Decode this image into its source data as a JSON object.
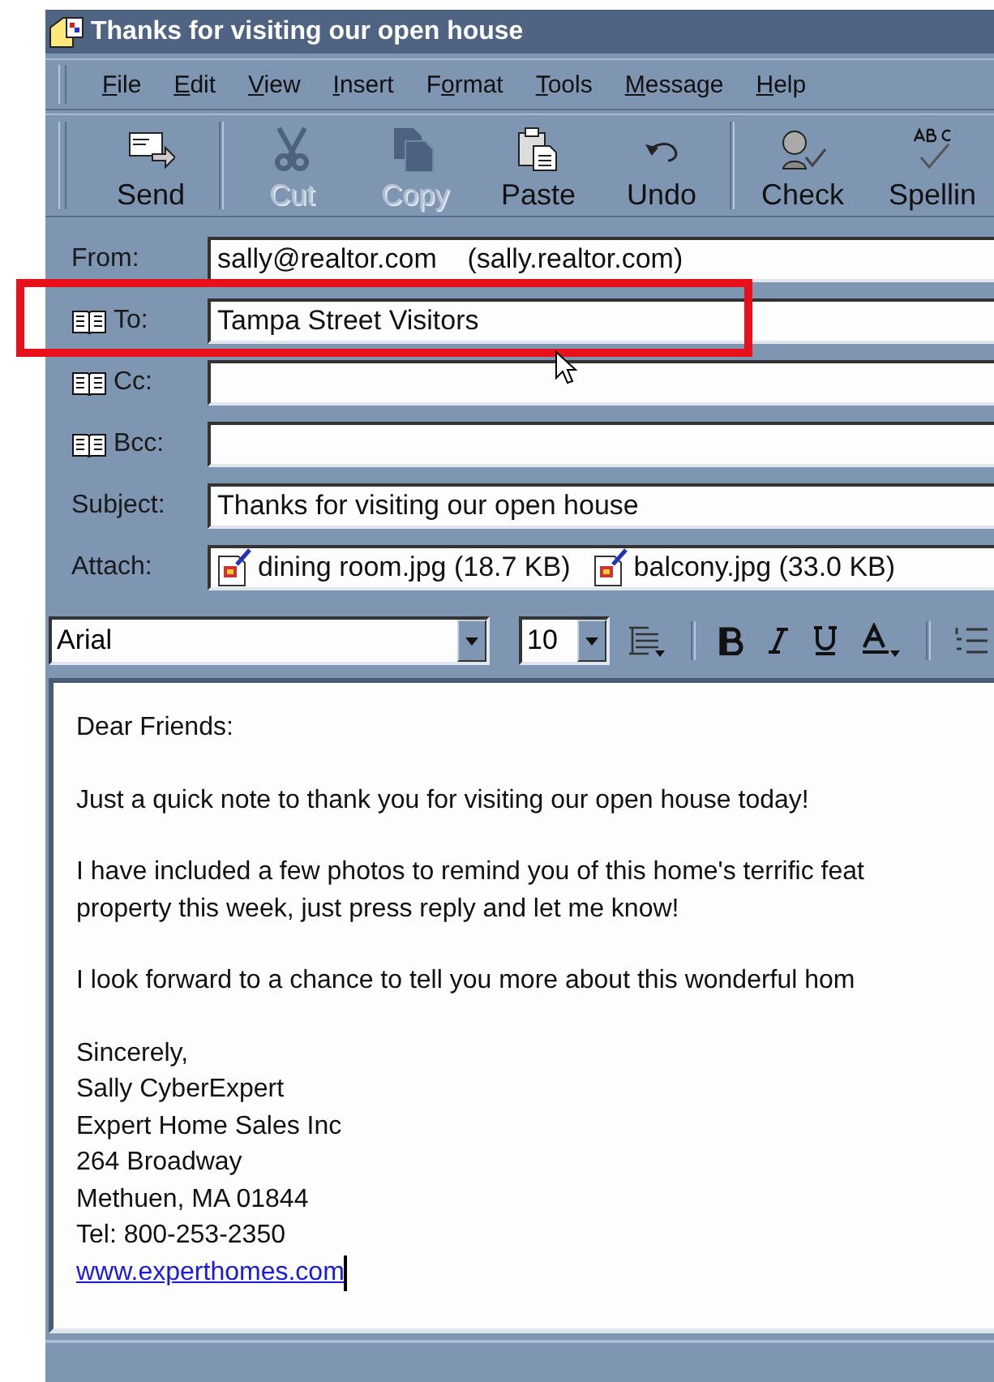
{
  "window": {
    "title": "Thanks for visiting our open house"
  },
  "menu": [
    {
      "access_key": "F",
      "after": "ile"
    },
    {
      "access_key": "E",
      "after": "dit"
    },
    {
      "access_key": "V",
      "after": "iew"
    },
    {
      "access_key": "I",
      "after": "nsert"
    },
    {
      "before": "F",
      "access_key": "o",
      "after": "rmat"
    },
    {
      "access_key": "T",
      "after": "ools"
    },
    {
      "access_key": "M",
      "after": "essage"
    },
    {
      "access_key": "H",
      "after": "elp"
    }
  ],
  "toolbar": [
    {
      "label": "Send",
      "kind": "send",
      "disabled": false,
      "separator_before": false
    },
    {
      "label": "Cut",
      "kind": "cut",
      "disabled": true,
      "separator_before": true
    },
    {
      "label": "Copy",
      "kind": "copy",
      "disabled": true,
      "separator_before": false
    },
    {
      "label": "Paste",
      "kind": "paste",
      "disabled": false,
      "separator_before": false
    },
    {
      "label": "Undo",
      "kind": "undo",
      "disabled": false,
      "separator_before": false
    },
    {
      "label": "Check",
      "kind": "check",
      "disabled": false,
      "separator_before": true
    },
    {
      "label": "Spellin",
      "kind": "spelling",
      "disabled": false,
      "separator_before": false
    }
  ],
  "headers": [
    {
      "label": "From:",
      "kind": "text",
      "address_book": false,
      "value": "sally@realtor.com    (sally.realtor.com)"
    },
    {
      "label": "To:",
      "kind": "text",
      "address_book": true,
      "value": "Tampa Street Visitors"
    },
    {
      "label": "Cc:",
      "kind": "text",
      "address_book": true
    },
    {
      "label": "Bcc:",
      "kind": "text",
      "address_book": true
    },
    {
      "label": "Subject:",
      "kind": "text",
      "address_book": false,
      "value": "Thanks for visiting our open house"
    },
    {
      "label": "Attach:",
      "kind": "attachments",
      "address_book": false,
      "files": [
        "dining room.jpg (18.7 KB)",
        "balcony.jpg (33.0 KB)"
      ]
    }
  ],
  "format_bar": {
    "font": "Arial",
    "size": "10"
  },
  "body": {
    "paragraphs": [
      [
        "Dear Friends:"
      ],
      [
        "Just a quick note to thank you for visiting our open house today!"
      ],
      [
        "I have included a few photos to remind you of this home's terrific feat",
        "property this week, just press reply and let me know!"
      ],
      [
        "I look forward to a chance to tell you more about this wonderful hom"
      ],
      [
        "Sincerely,",
        "Sally CyberExpert",
        "Expert Home Sales Inc",
        "264 Broadway",
        "Methuen, MA 01844",
        "Tel: 800-253-2350"
      ]
    ],
    "link": "www.experthomes.com"
  }
}
